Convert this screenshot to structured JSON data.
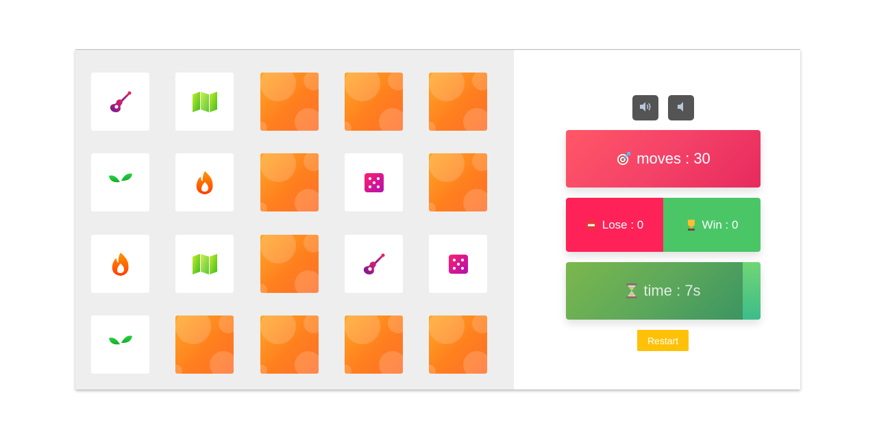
{
  "board": {
    "cards": [
      {
        "state": "face-up",
        "icon": "guitar-icon"
      },
      {
        "state": "face-up",
        "icon": "map-icon"
      },
      {
        "state": "face-down",
        "icon": ""
      },
      {
        "state": "face-down",
        "icon": ""
      },
      {
        "state": "face-down",
        "icon": ""
      },
      {
        "state": "face-up",
        "icon": "sprout-icon"
      },
      {
        "state": "face-up",
        "icon": "fire-icon"
      },
      {
        "state": "face-down",
        "icon": ""
      },
      {
        "state": "face-up",
        "icon": "dice-icon"
      },
      {
        "state": "face-down",
        "icon": ""
      },
      {
        "state": "face-up",
        "icon": "fire-icon"
      },
      {
        "state": "face-up",
        "icon": "map-icon"
      },
      {
        "state": "face-down",
        "icon": ""
      },
      {
        "state": "face-up",
        "icon": "guitar-icon"
      },
      {
        "state": "face-up",
        "icon": "dice-icon"
      },
      {
        "state": "face-up",
        "icon": "sprout-icon"
      },
      {
        "state": "face-down",
        "icon": ""
      },
      {
        "state": "face-down",
        "icon": ""
      },
      {
        "state": "face-down",
        "icon": ""
      },
      {
        "state": "face-down",
        "icon": ""
      }
    ]
  },
  "sound": {
    "on_icon": "speaker-on-icon",
    "off_icon": "speaker-off-icon"
  },
  "stats": {
    "moves_label": "moves : 30",
    "moves_icon": "target-icon",
    "lose_label": "Lose : 0",
    "lose_icon": "no-entry-icon",
    "win_label": "Win : 0",
    "win_icon": "trophy-icon",
    "time_label": "time : 7s",
    "time_icon": "hourglass-icon",
    "time_remaining_fraction": 0.09
  },
  "restart_label": "Restart",
  "colors": {
    "board_bg": "#eeeeee",
    "moves_bg": "#f44268",
    "lose_bg": "#fe2258",
    "win_bg": "#4ac667",
    "time_bg": "#5fa95a",
    "restart_bg": "#ffc107",
    "sound_btn_bg": "#545454"
  }
}
